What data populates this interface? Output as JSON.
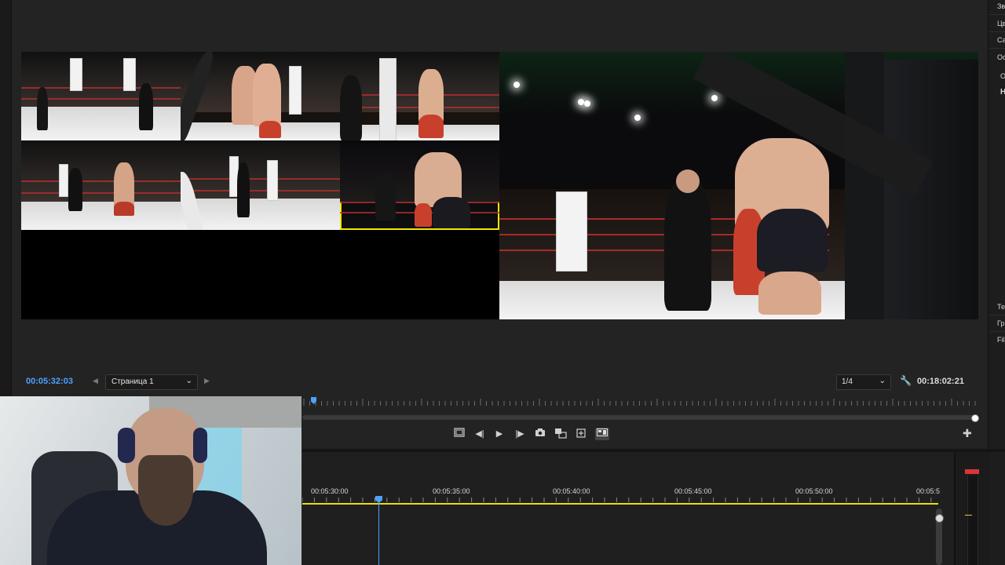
{
  "monitor": {
    "current_timecode": "00:05:32:03",
    "page_select": {
      "value": "Страница 1"
    },
    "zoom_select": {
      "value": "1/4"
    },
    "duration_timecode": "00:18:02:21"
  },
  "cameras": [
    {
      "id": "cam-1"
    },
    {
      "id": "cam-2"
    },
    {
      "id": "cam-3"
    },
    {
      "id": "cam-4"
    },
    {
      "id": "cam-5"
    },
    {
      "id": "cam-6",
      "selected": true
    }
  ],
  "timeline": {
    "ruler_labels": [
      "00:05:30:00",
      "00:05:35:00",
      "00:05:40:00",
      "00:05:45:00",
      "00:05:50:00",
      "00:05:5"
    ]
  },
  "right_panel": {
    "items": [
      "Зв",
      "Цв",
      "Са",
      "Ос",
      "О",
      "Н",
      "Те",
      "Гр",
      "Fil"
    ]
  },
  "colors": {
    "accent_blue": "#4ea1ff",
    "selected_outline": "#f3e600",
    "timeline_yellow": "#e5df1a",
    "meter_peak_red": "#d9353b"
  },
  "icons": {
    "transport": [
      "safe-margins-icon",
      "step-back-icon",
      "play-icon",
      "step-forward-icon",
      "camera-export-frame-icon",
      "insert-icon",
      "overwrite-icon",
      "multicam-toggle-icon"
    ],
    "misc": [
      "wrench-icon",
      "add-button-icon",
      "chevron-down-icon",
      "prev-page-icon",
      "next-page-icon"
    ]
  }
}
